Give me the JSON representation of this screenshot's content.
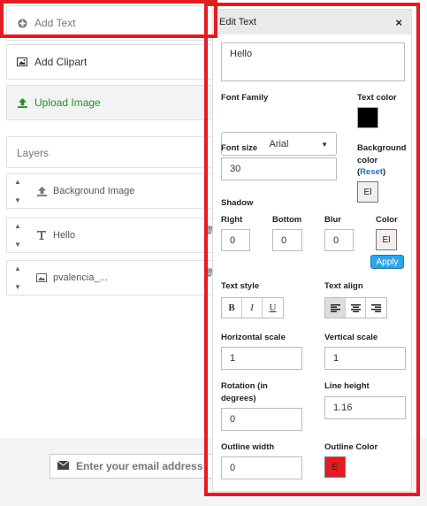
{
  "left_menu": {
    "add_text": "Add Text",
    "add_clipart": "Add Clipart",
    "upload_image": "Upload Image"
  },
  "layers": {
    "title": "Layers",
    "items": [
      {
        "label": "Background Image",
        "icon": "upload-icon"
      },
      {
        "label": "Hello",
        "icon": "text-icon"
      },
      {
        "label": "pvalencia_...",
        "icon": "image-icon"
      }
    ]
  },
  "footer": {
    "email_placeholder": "Enter your email address"
  },
  "edit_text": {
    "title": "Edit Text",
    "close": "×",
    "text_value": "Hello",
    "font_family_label": "Font Family",
    "font_family_value": "Arial",
    "text_color_label": "Text color",
    "text_color": "#000000",
    "font_size_label": "Font size",
    "font_size_value": "30",
    "bg_color_label_1": "Background",
    "bg_color_label_2": "color",
    "reset_open": "(",
    "reset_label": "Reset",
    "reset_close": ")",
    "bg_swatch_text": "El",
    "shadow_label": "Shadow",
    "shadow_right_label": "Right",
    "shadow_bottom_label": "Bottom",
    "shadow_blur_label": "Blur",
    "shadow_color_label": "Color",
    "shadow_right": "0",
    "shadow_bottom": "0",
    "shadow_blur": "0",
    "shadow_swatch_text": "El",
    "apply_label": "Apply",
    "text_style_label": "Text style",
    "bold": "B",
    "italic": "I",
    "underline": "U",
    "text_align_label": "Text align",
    "h_scale_label": "Horizontal scale",
    "h_scale": "1",
    "v_scale_label": "Vertical scale",
    "v_scale": "1",
    "rotation_label_1": "Rotation (in",
    "rotation_label_2": "degrees)",
    "rotation": "0",
    "line_height_label": "Line height",
    "line_height": "1.16",
    "outline_width_label": "Outline width",
    "outline_width": "0",
    "outline_color_label": "Outline Color",
    "outline_swatch_text": "E",
    "outline_color": "#e31b23"
  },
  "colors": {
    "highlight_red": "#e31b23",
    "apply_blue": "#2fa4e7",
    "upload_green": "#2a8a2a"
  }
}
